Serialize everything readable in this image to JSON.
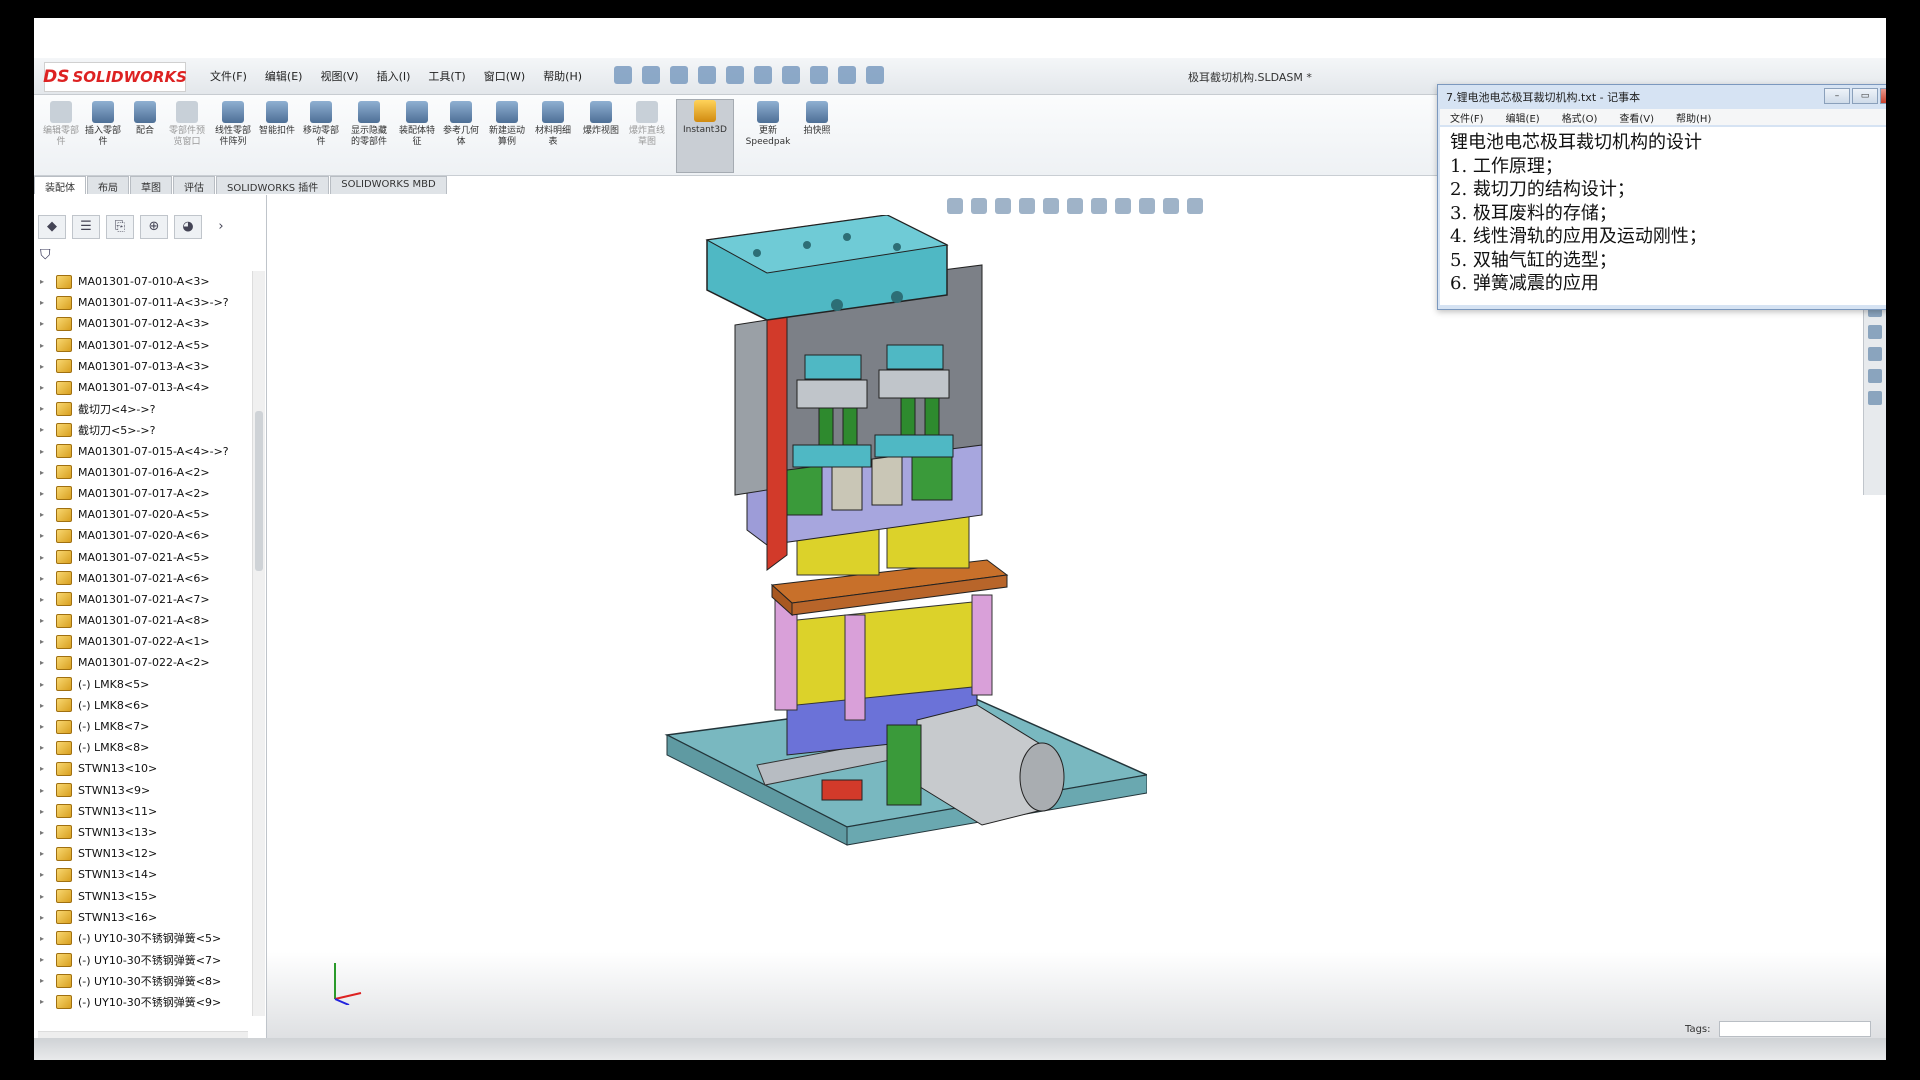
{
  "app": {
    "logo_text": "SOLIDWORKS",
    "logo_mark": "DS",
    "document_title": "极耳截切机构.SLDASM *"
  },
  "menus": [
    "文件(F)",
    "编辑(E)",
    "视图(V)",
    "插入(I)",
    "工具(T)",
    "窗口(W)",
    "帮助(H)"
  ],
  "ribbon": {
    "buttons": [
      {
        "label": "编辑零部件",
        "dim": true
      },
      {
        "label": "插入零部件",
        "dim": false
      },
      {
        "label": "配合",
        "dim": false
      },
      {
        "label": "零部件预览窗口",
        "dim": true
      },
      {
        "label": "线性零部件阵列",
        "dim": false
      },
      {
        "label": "智能扣件",
        "dim": false
      },
      {
        "label": "移动零部件",
        "dim": false
      },
      {
        "label": "显示隐藏的零部件",
        "dim": false
      },
      {
        "label": "装配体特征",
        "dim": false
      },
      {
        "label": "参考几何体",
        "dim": false
      },
      {
        "label": "新建运动算例",
        "dim": false
      },
      {
        "label": "材料明细表",
        "dim": false
      },
      {
        "label": "爆炸视图",
        "dim": false
      },
      {
        "label": "爆炸直线草图",
        "dim": true
      },
      {
        "label": "Instant3D",
        "dim": false,
        "active": true
      },
      {
        "label": "更新Speedpak",
        "dim": false
      },
      {
        "label": "拍快照",
        "dim": false
      }
    ]
  },
  "tabs": [
    "装配体",
    "布局",
    "草图",
    "评估",
    "SOLIDWORKS 插件",
    "SOLIDWORKS MBD"
  ],
  "tree": {
    "items": [
      "MA01301-07-010-A<3>",
      "MA01301-07-011-A<3>->?",
      "MA01301-07-012-A<3>",
      "MA01301-07-012-A<5>",
      "MA01301-07-013-A<3>",
      "MA01301-07-013-A<4>",
      "截切刀<4>->?",
      "截切刀<5>->?",
      "MA01301-07-015-A<4>->?",
      "MA01301-07-016-A<2>",
      "MA01301-07-017-A<2>",
      "MA01301-07-020-A<5>",
      "MA01301-07-020-A<6>",
      "MA01301-07-021-A<5>",
      "MA01301-07-021-A<6>",
      "MA01301-07-021-A<7>",
      "MA01301-07-021-A<8>",
      "MA01301-07-022-A<1>",
      "MA01301-07-022-A<2>",
      "(-) LMK8<5>",
      "(-) LMK8<6>",
      "(-) LMK8<7>",
      "(-) LMK8<8>",
      "STWN13<10>",
      "STWN13<9>",
      "STWN13<11>",
      "STWN13<13>",
      "STWN13<12>",
      "STWN13<14>",
      "STWN13<15>",
      "STWN13<16>",
      "(-) UY10-30不锈钢弹簧<5>",
      "(-) UY10-30不锈钢弹簧<7>",
      "(-) UY10-30不锈钢弹簧<8>",
      "(-) UY10-30不锈钢弹簧<9>"
    ]
  },
  "status": {
    "tags_label": "Tags:"
  },
  "notepad": {
    "title": "7.锂电池电芯极耳裁切机构.txt - 记事本",
    "menus": [
      "文件(F)",
      "编辑(E)",
      "格式(O)",
      "查看(V)",
      "帮助(H)"
    ],
    "lines": [
      "锂电池电芯极耳裁切机构的设计",
      "1. 工作原理；",
      "2. 裁切刀的结构设计；",
      "3. 极耳废料的存储；",
      "4. 线性滑轨的应用及运动刚性；",
      "5. 双轴气缸的选型；",
      "6. 弹簧减震的应用"
    ]
  },
  "colors": {
    "teal": "#4fb8c4",
    "gray": "#8b8f96",
    "red": "#d23a2a",
    "lavender": "#9d9cd8",
    "yellow": "#dcd22a",
    "orange": "#c8702a",
    "pink": "#d98fd0",
    "green": "#3a9a3a",
    "base": "#79b8c0"
  }
}
